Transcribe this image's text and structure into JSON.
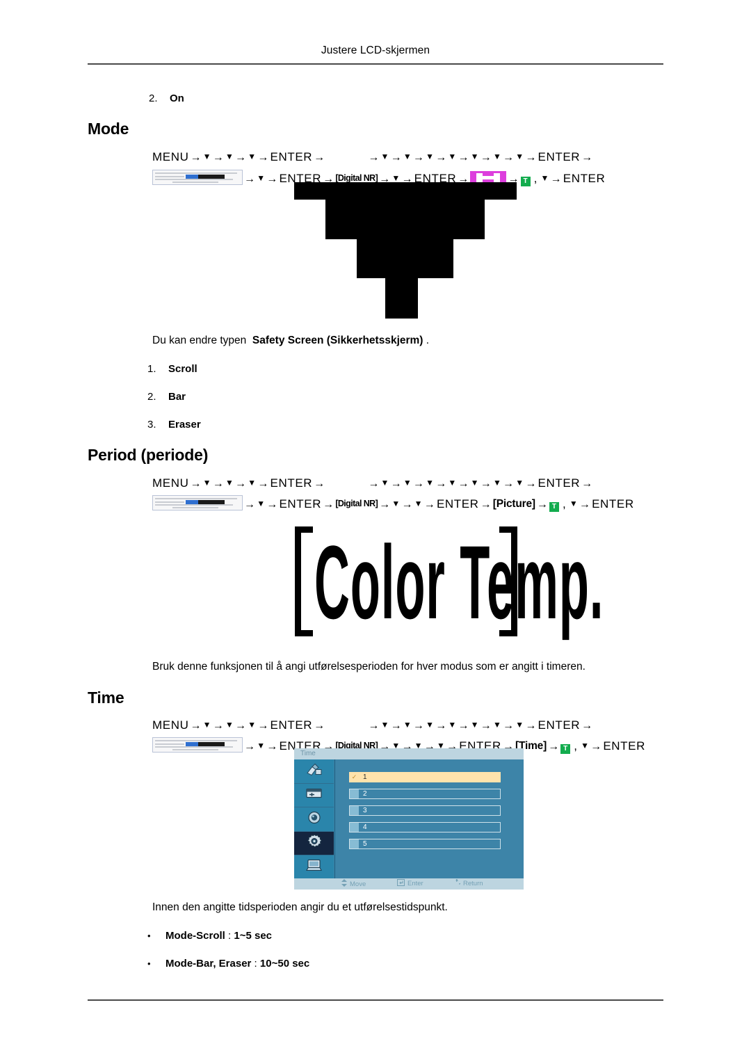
{
  "header": {
    "running_head": "Justere LCD-skjermen"
  },
  "top_item": {
    "num": "2.",
    "label": "On"
  },
  "sections": {
    "mode": {
      "title": "Mode",
      "sequence": {
        "line1_start": "MENU",
        "enter": "ENTER",
        "line2_token_digital_nr": "[Digital NR]",
        "badge_green_letter": "T",
        "icon_magenta": "magenta-h-badge"
      },
      "body_text_pre": "Du kan endre typen",
      "body_text_bold": "Safety Screen (Sikkerhetsskjerm)",
      "body_text_post": ".",
      "list": [
        {
          "num": "1.",
          "label": "Scroll"
        },
        {
          "num": "2.",
          "label": "Bar"
        },
        {
          "num": "3.",
          "label": "Eraser"
        }
      ]
    },
    "period": {
      "title": "Period (periode)",
      "sequence": {
        "line1_start": "MENU",
        "enter": "ENTER",
        "line2_token_digital_nr": "[Digital NR]",
        "token_picture": "[Picture]",
        "badge_green_letter": "T"
      },
      "wordart": "Color Temp.",
      "body_text": "Bruk denne funksjonen til å angi utførelsesperioden for hver modus som er angitt i timeren."
    },
    "time": {
      "title": "Time",
      "sequence": {
        "line1_start": "MENU",
        "enter": "ENTER",
        "line2_token_digital_nr": "[Digital NR]",
        "token_time": "[Time]",
        "badge_green_letter": "T"
      },
      "osd": {
        "title": "Time",
        "rail_icons": [
          "picture-brush-icon",
          "screen-adjust-icon",
          "sound-icon",
          "setup-gear-icon",
          "multi-control-icon"
        ],
        "selected_rail_index": 3,
        "rows": [
          {
            "label": "1",
            "selected": true
          },
          {
            "label": "2",
            "selected": false
          },
          {
            "label": "3",
            "selected": false
          },
          {
            "label": "4",
            "selected": false
          },
          {
            "label": "5",
            "selected": false
          }
        ],
        "footer": [
          {
            "icon": "up-down-arrow-icon",
            "label": "Move"
          },
          {
            "icon": "enter-key-icon",
            "label": "Enter"
          },
          {
            "icon": "return-arrow-icon",
            "label": "Return"
          }
        ]
      },
      "body_text": "Innen den angitte tidsperioden angir du et utførelsestidspunkt.",
      "bullets": [
        {
          "label": "Mode-Scroll",
          "sep": " : ",
          "value": "1~5 sec"
        },
        {
          "label": "Mode-Bar, Eraser",
          "sep": " : ",
          "value": "10~50 sec"
        }
      ]
    }
  },
  "glyphs": {
    "arrow_right": "→",
    "down_triangle": "▼",
    "bullet": "•"
  },
  "colors": {
    "magenta": "#dd3edd",
    "green": "#13ac4e",
    "osd_blue": "#3d84a8",
    "osd_bar": "#bdd5e0",
    "osd_highlight": "#ffe3ac",
    "osd_selected": "#14253f"
  }
}
